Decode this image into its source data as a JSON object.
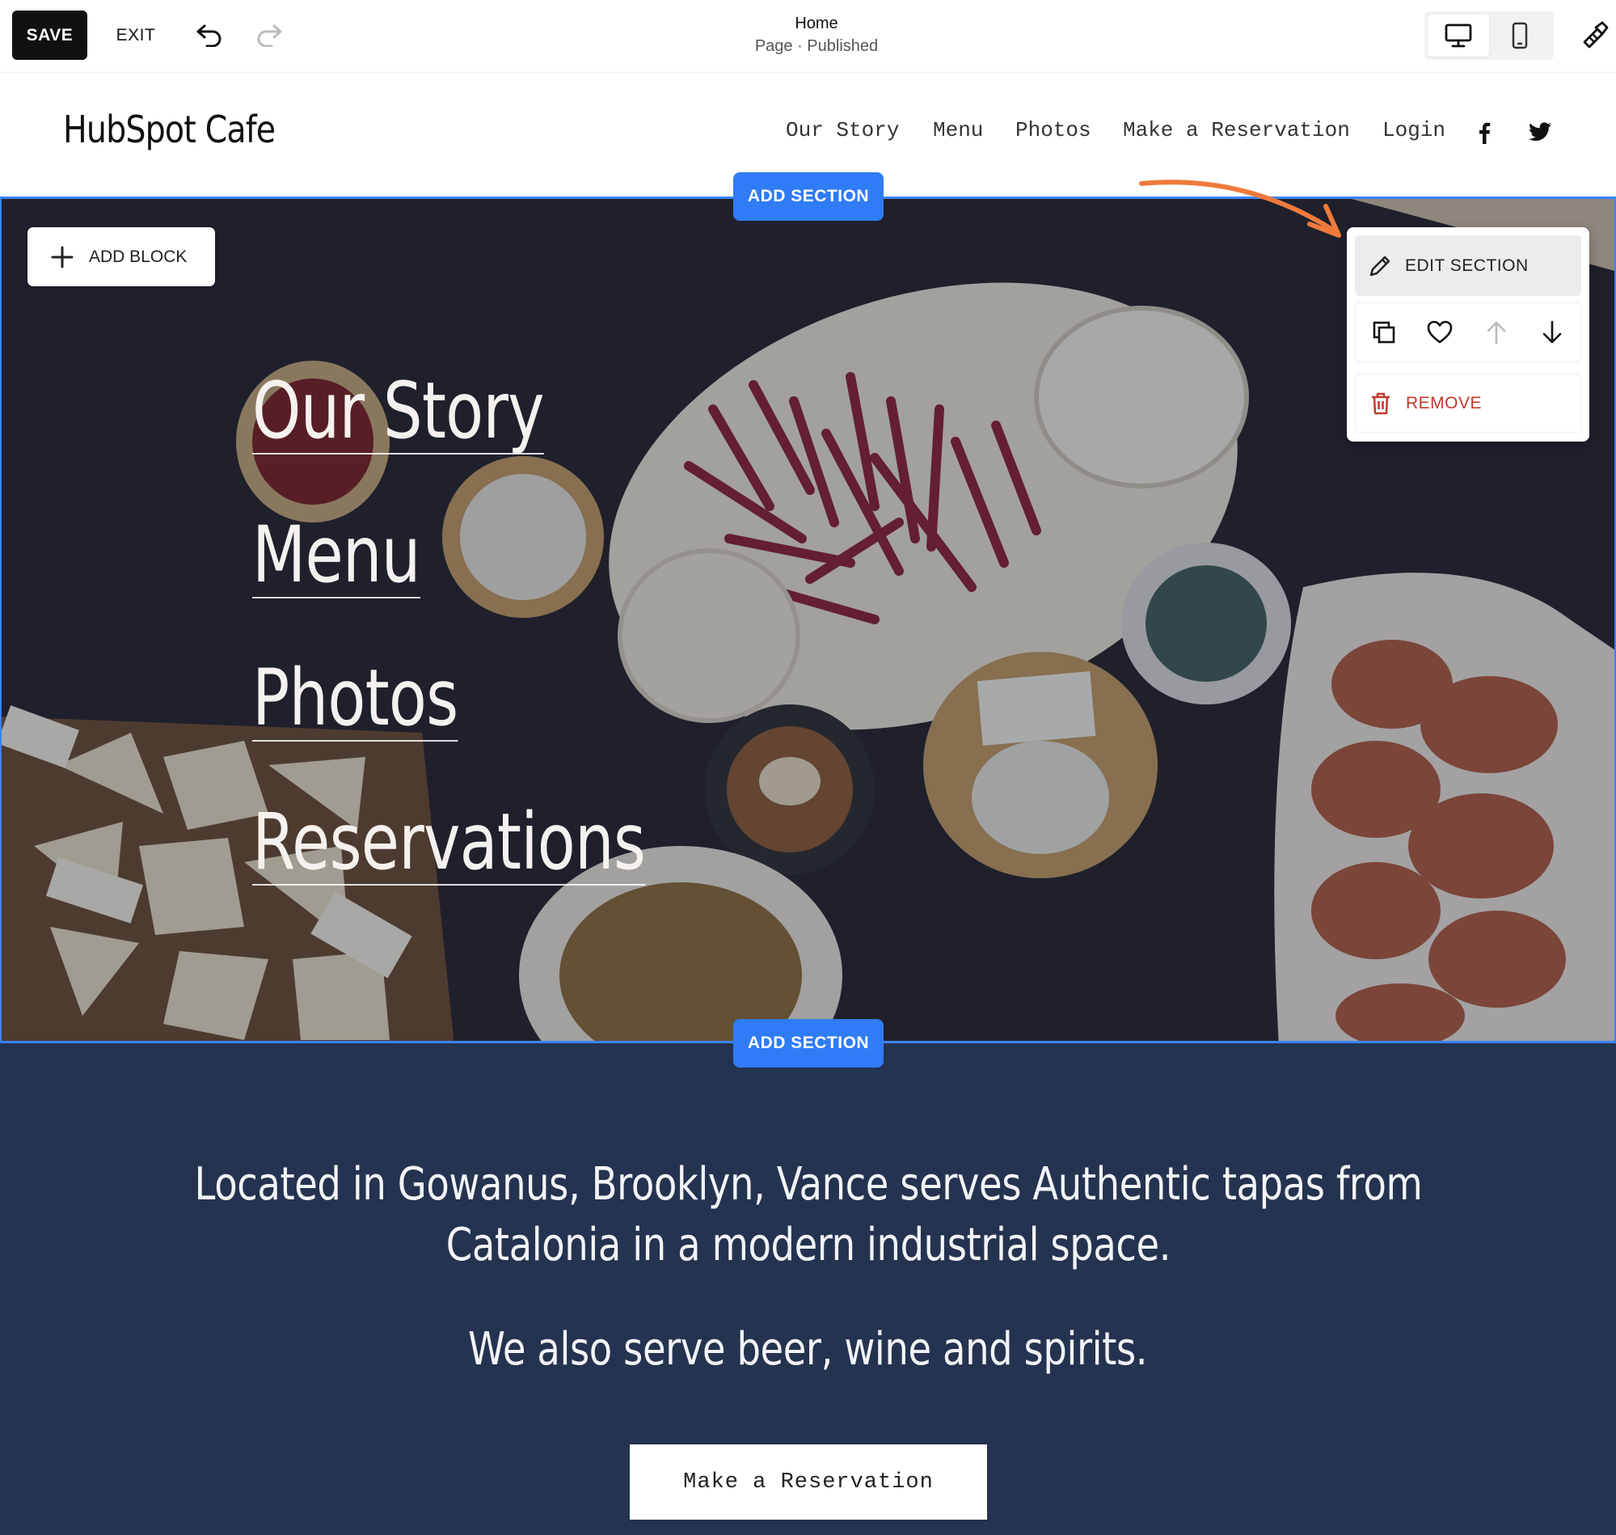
{
  "toolbar": {
    "save_label": "SAVE",
    "exit_label": "EXIT",
    "page_title": "Home",
    "page_status": "Page · Published",
    "icons": [
      "undo-icon",
      "redo-icon",
      "desktop-icon",
      "mobile-icon",
      "site-styles-icon"
    ]
  },
  "site": {
    "title": "HubSpot Cafe",
    "nav": [
      "Our Story",
      "Menu",
      "Photos",
      "Make a Reservation",
      "Login"
    ],
    "social": [
      "facebook-icon",
      "twitter-icon"
    ]
  },
  "editor": {
    "add_section_label": "ADD SECTION",
    "add_block_label": "ADD BLOCK",
    "panel": {
      "edit_label": "EDIT SECTION",
      "remove_label": "REMOVE",
      "action_icons": [
        "duplicate-icon",
        "heart-icon",
        "arrow-up-icon",
        "arrow-down-icon"
      ]
    },
    "accent_color": "#2f7cf6",
    "annotation_arrow_color": "#f07a3b"
  },
  "hero": {
    "links": [
      "Our Story",
      "Menu",
      "Photos",
      "Reservations"
    ]
  },
  "info": {
    "line1": "Located in Gowanus, Brooklyn, Vance serves Authentic tapas from",
    "line2": "Catalonia in a modern industrial space.",
    "line3": "We also serve beer, wine and spirits.",
    "cta_label": "Make a Reservation",
    "background": "#243350"
  }
}
